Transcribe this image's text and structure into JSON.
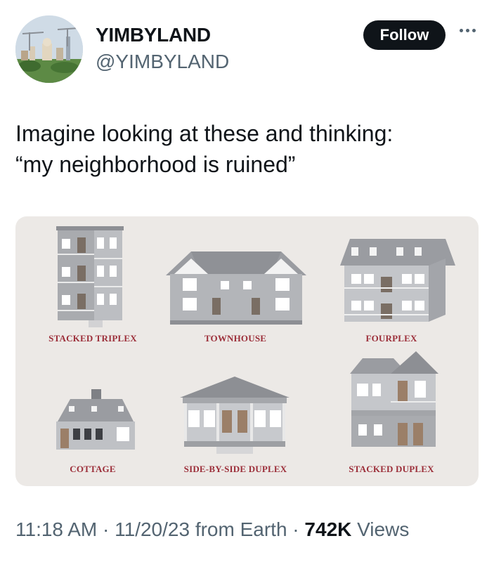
{
  "author": {
    "name": "YIMBYLAND",
    "handle": "@YIMBYLAND"
  },
  "follow_label": "Follow",
  "more_icon": "more-horizontal-icon",
  "tweet": {
    "lines": [
      "Imagine looking at these and thinking:",
      "“my neighborhood is ruined”"
    ]
  },
  "media": {
    "captions": {
      "stacked_triplex": "STACKED TRIPLEX",
      "townhouse": "TOWNHOUSE",
      "fourplex": "FOURPLEX",
      "cottage": "COTTAGE",
      "side_by_side_duplex": "SIDE-BY-SIDE DUPLEX",
      "stacked_duplex": "STACKED DUPLEX"
    }
  },
  "footer": {
    "time": "11:18 AM",
    "sep1": " · ",
    "date": "11/20/23",
    "source": " from Earth",
    "sep2": " · ",
    "views_count": "742K",
    "views_label": " Views"
  },
  "colors": {
    "caption": "#9c2f3a",
    "card_bg": "#ece9e6",
    "follow_bg": "#0f1419",
    "secondary_text": "#536471"
  }
}
